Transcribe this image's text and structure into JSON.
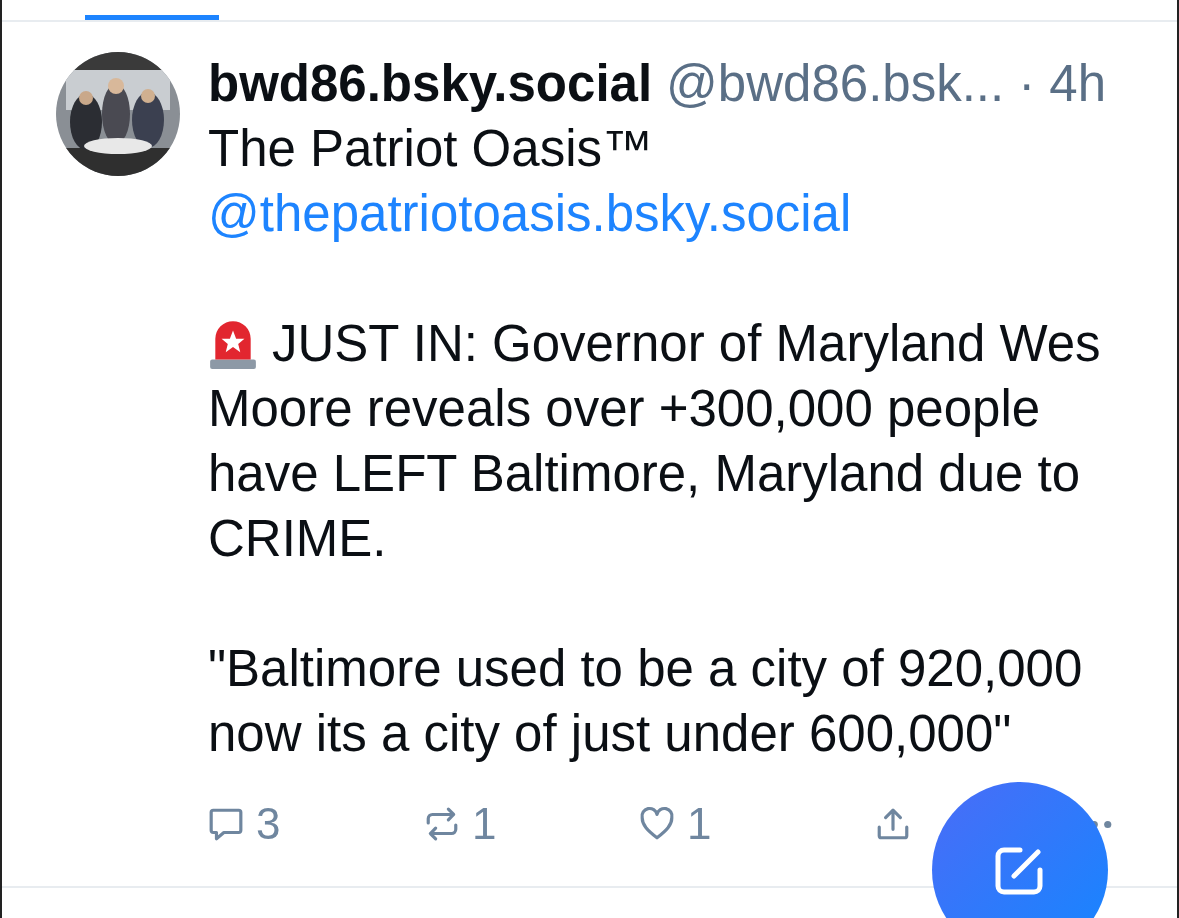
{
  "tabs": [
    {
      "selected": true
    }
  ],
  "post": {
    "display_name": "bwd86.bsky.social",
    "handle": "@bwd86.bsk...",
    "time": "· 4h",
    "body": [
      {
        "kind": "text",
        "text": "The Patriot Oasis™"
      },
      {
        "kind": "mention",
        "text": "@thepatriotoasis.bsky.social"
      },
      {
        "kind": "alert",
        "first_line": "JUST IN: Governor of Maryland Wes",
        "rest": "Moore reveals over +300,000 people\nhave LEFT Baltimore, Maryland due to\nCRIME."
      },
      {
        "kind": "text",
        "text": "\"Baltimore used to be a city of 920,000\nnow its a city of just under 600,000\""
      }
    ],
    "actions": [
      {
        "kind": "reply",
        "count": "3"
      },
      {
        "kind": "repost",
        "count": "1"
      },
      {
        "kind": "like",
        "count": "1"
      },
      {
        "kind": "share"
      },
      {
        "kind": "more"
      }
    ]
  }
}
